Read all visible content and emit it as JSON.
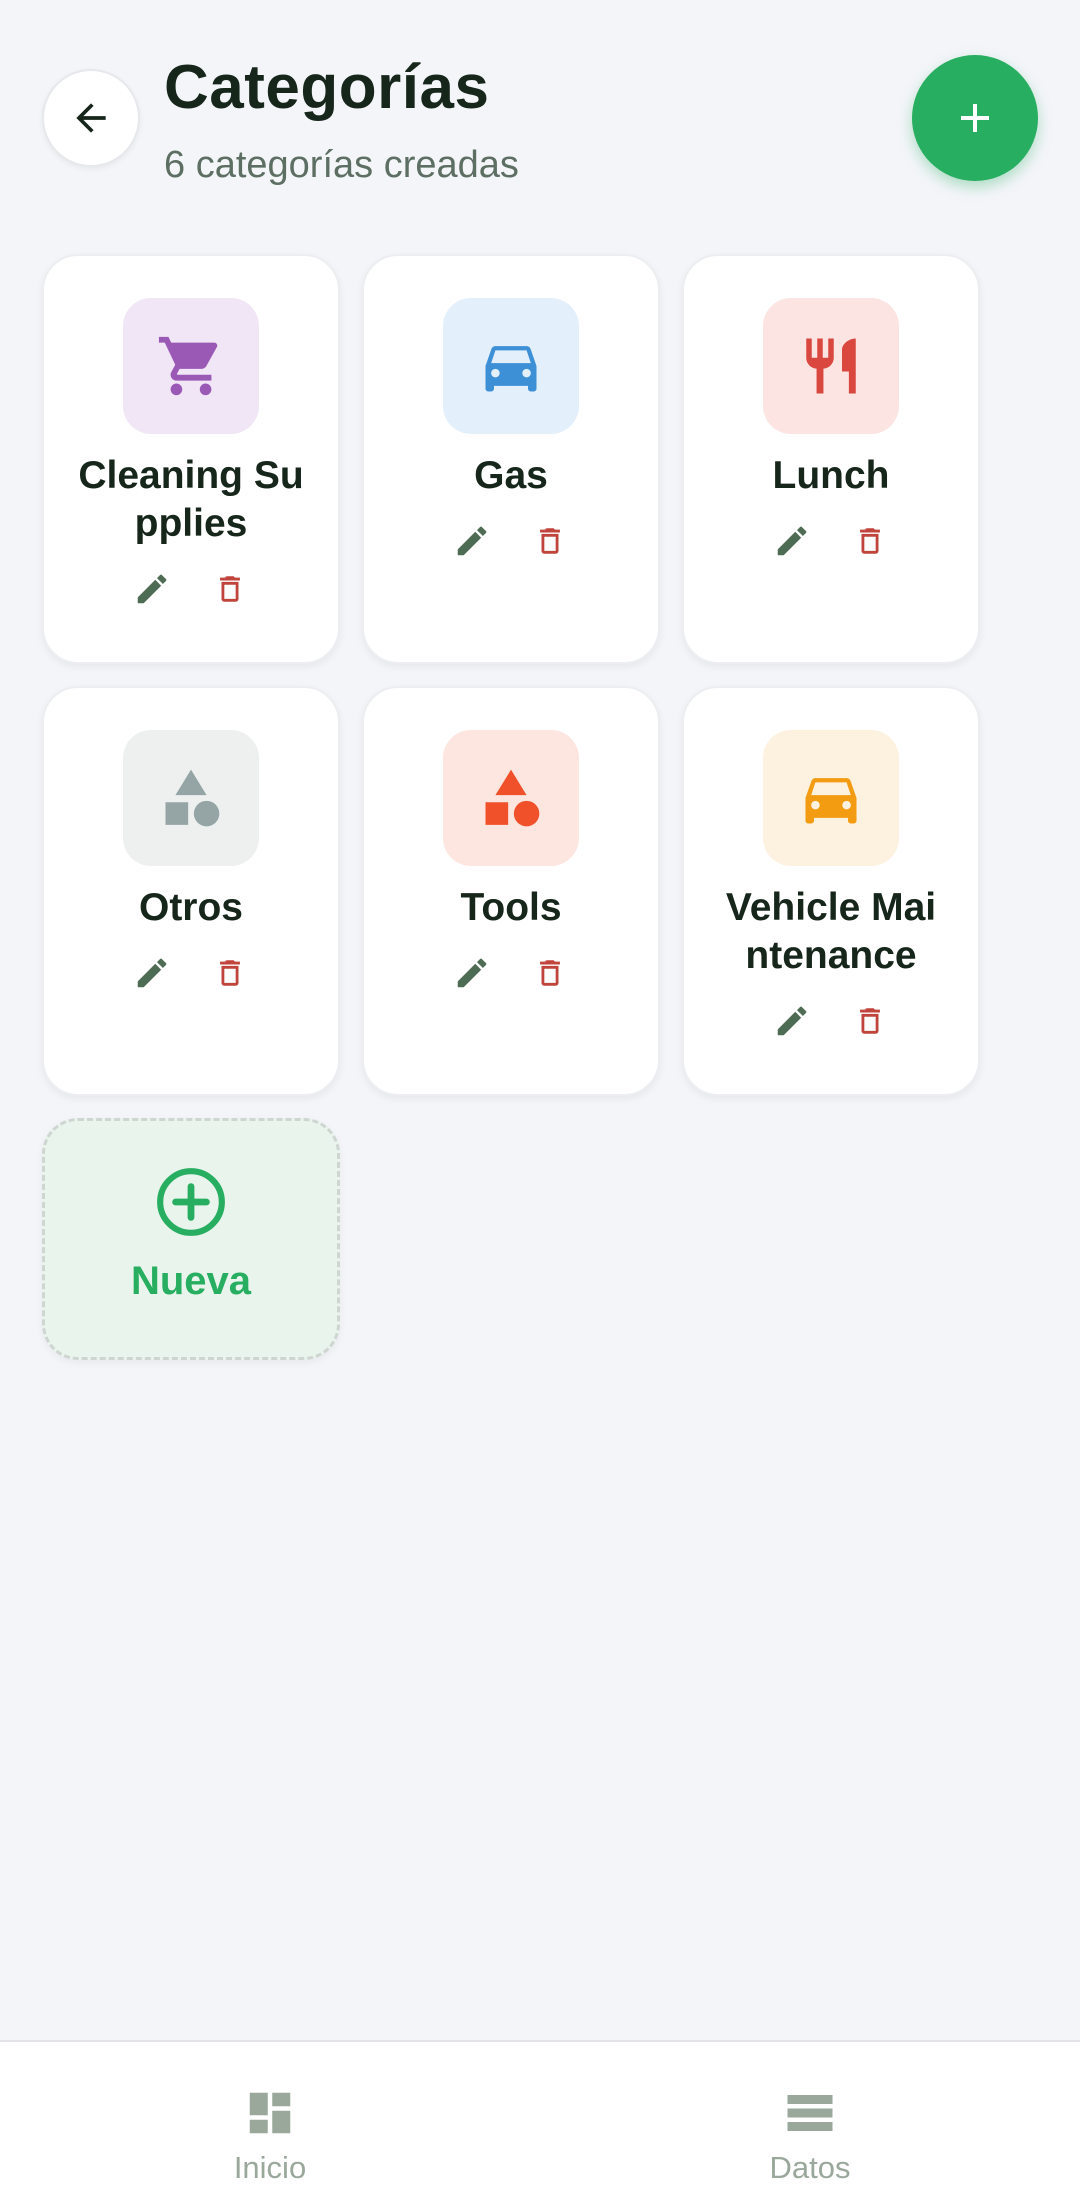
{
  "header": {
    "title": "Categorías",
    "subtitle": "6 categorías creadas"
  },
  "categories": [
    {
      "name": "Cleaning Supplies",
      "icon": "cart-icon",
      "color": "#9b59b6",
      "bg": "#f0e6f6"
    },
    {
      "name": "Gas",
      "icon": "car-icon",
      "color": "#3d8fd6",
      "bg": "#e3f0fb"
    },
    {
      "name": "Lunch",
      "icon": "utensils-icon",
      "color": "#d9473f",
      "bg": "#fbe4e2"
    },
    {
      "name": "Otros",
      "icon": "shapes-icon",
      "color": "#95a5a6",
      "bg": "#eef0f0"
    },
    {
      "name": "Tools",
      "icon": "shapes-icon",
      "color": "#f0512a",
      "bg": "#fde6df"
    },
    {
      "name": "Vehicle Mai ntenance",
      "icon": "car-icon",
      "color": "#f39c12",
      "bg": "#fdf1e0"
    }
  ],
  "new_card": {
    "label": "Nueva"
  },
  "nav": {
    "items": [
      {
        "label": "Inicio",
        "icon": "dashboard-icon"
      },
      {
        "label": "Datos",
        "icon": "list-icon"
      }
    ]
  },
  "colors": {
    "accent": "#27ae60",
    "edit": "#4e6b53",
    "delete": "#c0443c",
    "nav_inactive": "#9aa89c"
  }
}
